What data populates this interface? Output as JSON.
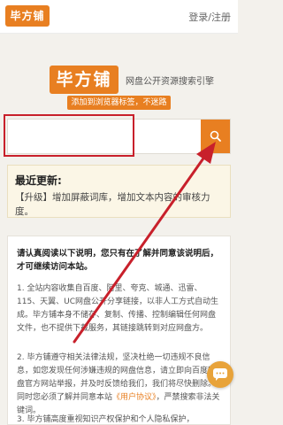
{
  "header": {
    "logo_text": "毕方铺",
    "auth_link": "登录/注册"
  },
  "brand": {
    "name": "毕方铺",
    "slogan": "网盘公开资源搜索引擎",
    "bookmark_button": "添加到浏览器标签，不迷路"
  },
  "search": {
    "value": "",
    "placeholder": "",
    "button_icon": "search-icon"
  },
  "updates": {
    "title": "最近更新:",
    "text": "【升级】增加屏蔽词库，增加文本内容的审核力度。"
  },
  "notice": {
    "intro": "请认真阅读以下说明，您只有在了解并同意该说明后，才可继续访问本站。",
    "item1": "1. 全站内容收集自百度、阿里、夸克、城通、迅雷、115、天翼、UC网盘公开分享链接，以非人工方式自动生成。毕方铺本身不储存、复制、传播、控制编辑任何网盘文件，也不提供下载服务，其链接跳转到对应网盘方。",
    "item2_before": "2. 毕方铺遵守相关法律法规，坚决杜绝一切违规不良信息，如您发现任何涉嫌违规的网盘信息，请立即向百度网盘官方网站举报，并及时反馈给我们，我们将尽快删除。同时您必须了解并同意本站",
    "item2_link": "《用户协议》",
    "item2_after": "，严禁搜索非法关键词。",
    "item3": "3. 毕方铺高度重视知识产权保护和个人隐私保护，"
  },
  "annotation": {
    "color": "#c8202b"
  },
  "colors": {
    "accent": "#e87f21",
    "page_bg": "#f3f1ec",
    "update_bg": "#fbf6e6"
  }
}
